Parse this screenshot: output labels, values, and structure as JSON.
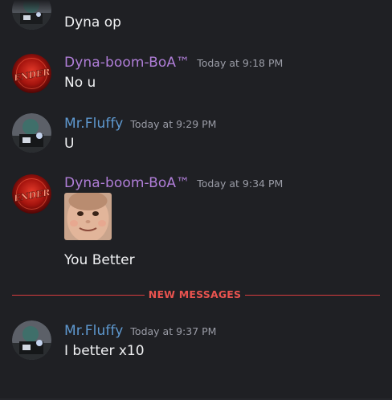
{
  "colors": {
    "background": "#1f2024",
    "username_dyna": "#b07ed8",
    "username_fluffy": "#5e98cf",
    "timestamp": "#9a9ca6",
    "message_text": "#f0f1f3",
    "new_messages_accent": "#e8534f"
  },
  "messages": [
    {
      "user": "",
      "time": "",
      "text": "Dyna op",
      "avatar_icon": "mr-fluffy-avatar-icon"
    },
    {
      "user": "Dyna-boom-BoA™",
      "time": "Today at 9:18 PM",
      "text": "No u",
      "avatar_icon": "ender-avatar-icon",
      "avatar_text": "ENDER"
    },
    {
      "user": "Mr.Fluffy",
      "time": "Today at 9:29 PM",
      "text": "U",
      "avatar_icon": "mr-fluffy-avatar-icon"
    },
    {
      "user": "Dyna-boom-BoA™",
      "time": "Today at 9:34 PM",
      "attachment_icon": "baby-face-image",
      "text": "You Better",
      "avatar_icon": "ender-avatar-icon",
      "avatar_text": "ENDER"
    },
    {
      "user": "Mr.Fluffy",
      "time": "Today at 9:37 PM",
      "text": "I better x10",
      "avatar_icon": "mr-fluffy-avatar-icon"
    }
  ],
  "divider": {
    "label": "NEW MESSAGES"
  }
}
